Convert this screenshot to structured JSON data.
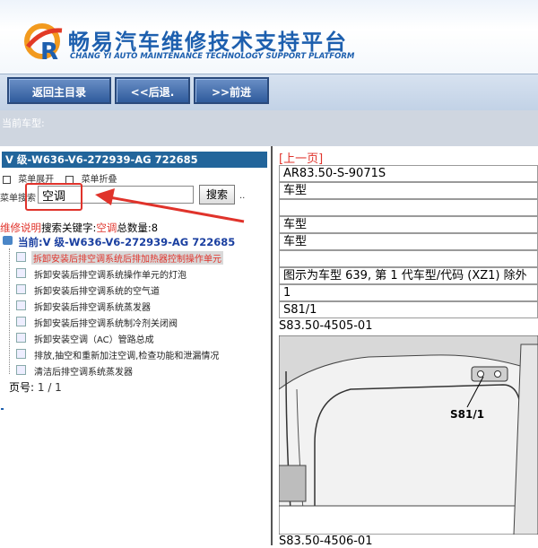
{
  "header": {
    "title_cn": "畅易汽车维修技术支持平台",
    "title_en": "CHANG YI AUTO MAINTENANCE TECHNOLOGY SUPPORT PLATFORM"
  },
  "toolbar": {
    "home": "返回主目录",
    "back": "<<后退.",
    "forward": ">>前进"
  },
  "current_car": {
    "label": "当前车型:"
  },
  "left": {
    "header": "V 级-W636-V6-272939-AG 722685",
    "expand": "菜单展开",
    "collapse": "菜单折叠",
    "search_label": "菜单搜索",
    "search_value": "空调",
    "search_button": "搜索",
    "result": {
      "prefix": "维修说明",
      "keyword_label": "搜索关键字:",
      "keyword": "空调",
      "total_label": "总数量:",
      "total": "8"
    },
    "current": "当前:V 级-W636-V6-272939-AG 722685",
    "items": [
      "拆卸安装后排空调系统后排加热器控制操作单元",
      "拆卸安装后排空调系统操作单元的灯泡",
      "拆卸安装后排空调系统的空气道",
      "拆卸安装后排空调系统蒸发器",
      "拆卸安装后排空调系统制冷剂关闭阀",
      "拆卸安装空调（AC）管路总成",
      "排放,抽空和重新加注空调,检查功能和泄漏情况",
      "清洁后排空调系统蒸发器"
    ],
    "page_label": "页号:",
    "page_value": "1 / 1"
  },
  "right": {
    "prev": "[上一页]",
    "rows": [
      "AR83.50-S-9071S",
      "车型",
      "",
      "车型",
      "车型",
      "",
      "图示为车型 639, 第 1 代车型/代码 (XZ1) 除外",
      "1",
      "S81/1"
    ],
    "fig1_caption": "S83.50-4505-01",
    "fig1_label": "S81/1",
    "fig2_caption": "S83.50-4506-01"
  },
  "colors": {
    "brand_blue": "#1d5fae",
    "accent_red": "#e0332b",
    "left_header": "#22659b"
  }
}
